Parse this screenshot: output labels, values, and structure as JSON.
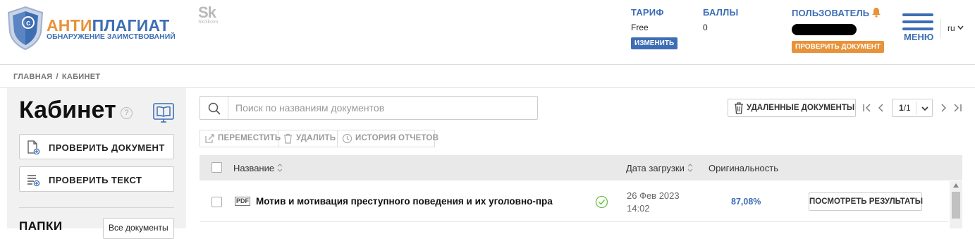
{
  "header": {
    "logo": {
      "word_a": "АНТИ",
      "word_b": "ПЛАГИАТ",
      "subtitle": "ОБНАРУЖЕНИЕ ЗАИМСТВОВАНИЙ",
      "shield_glyph": "©"
    },
    "skolkovo": {
      "mark": "Sk",
      "text": "Skolkovo"
    },
    "tariff": {
      "label": "ТАРИФ",
      "value": "Free",
      "button": "ИЗМЕНИТЬ"
    },
    "points": {
      "label": "БАЛЛЫ",
      "value": "0"
    },
    "user": {
      "label": "ПОЛЬЗОВАТЕЛЬ",
      "button": "ПРОВЕРИТЬ ДОКУМЕНТ"
    },
    "menu_label": "МЕНЮ",
    "language": "ru"
  },
  "breadcrumb": {
    "home": "ГЛАВНАЯ",
    "separator": "/",
    "current": "КАБИНЕТ"
  },
  "sidebar": {
    "title": "Кабинет",
    "help_glyph": "?",
    "check_document": "ПРОВЕРИТЬ ДОКУМЕНТ",
    "check_text": "ПРОВЕРИТЬ ТЕКСТ",
    "folders_title": "ПАПКИ",
    "all_docs": "Все документы"
  },
  "search": {
    "placeholder": "Поиск по названиям документов",
    "value": ""
  },
  "deleted_docs": "УДАЛЕННЫЕ ДОКУМЕНТЫ",
  "pagination": {
    "current": "1",
    "total": "/1"
  },
  "toolbar": {
    "move": "ПЕРЕМЕСТИТЬ",
    "delete": "УДАЛИТЬ",
    "history": "ИСТОРИЯ ОТЧЕТОВ"
  },
  "table": {
    "columns": {
      "name": "Название",
      "date": "Дата загрузки",
      "originality": "Оригинальность"
    },
    "rows": [
      {
        "type": "PDF",
        "title": "Мотив и мотивация преступного поведения и их уголовно-пра",
        "date": "26 Фев 2023",
        "time": "14:02",
        "originality": "87,08%",
        "action": "ПОСМОТРЕТЬ РЕЗУЛЬТАТЫ"
      }
    ]
  },
  "colors": {
    "brand_blue": "#3d6eb4",
    "brand_orange": "#e8923a",
    "ok_green": "#6cbf4a"
  },
  "icons": [
    "shield-logo-icon",
    "bell-icon",
    "hamburger-icon",
    "chevron-down-icon",
    "help-icon",
    "book-icon",
    "document-add-icon",
    "text-add-icon",
    "search-icon",
    "trash-icon",
    "first-page-icon",
    "prev-page-icon",
    "next-page-icon",
    "last-page-icon",
    "move-icon",
    "history-icon",
    "sort-icon",
    "pdf-icon",
    "check-circle-icon"
  ]
}
